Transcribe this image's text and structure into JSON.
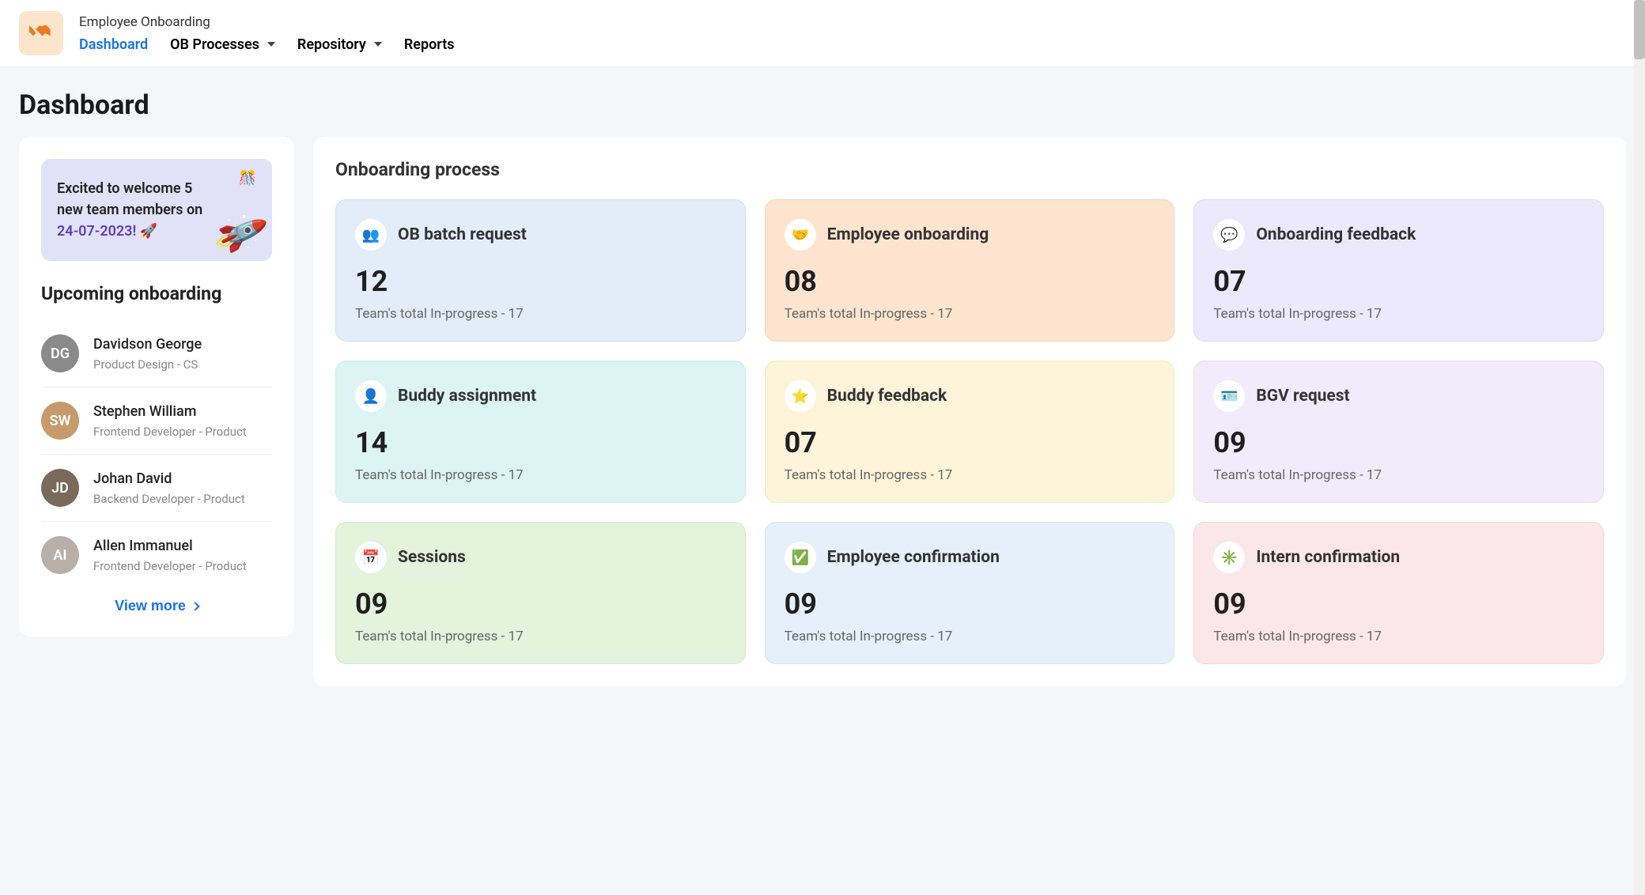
{
  "header": {
    "app_title": "Employee Onboarding",
    "nav": [
      {
        "label": "Dashboard",
        "active": true,
        "dropdown": false
      },
      {
        "label": "OB Processes",
        "active": false,
        "dropdown": true
      },
      {
        "label": "Repository",
        "active": false,
        "dropdown": true
      },
      {
        "label": "Reports",
        "active": false,
        "dropdown": false
      }
    ]
  },
  "page_title": "Dashboard",
  "welcome": {
    "line1": "Excited to welcome 5",
    "line2": "new team members on",
    "date": "24-07-2023!",
    "emoji": "🚀"
  },
  "upcoming": {
    "title": "Upcoming onboarding",
    "users": [
      {
        "name": "Davidson George",
        "role": "Product Design - CS",
        "avatar_bg": "#8a8a8a",
        "initials": "DG"
      },
      {
        "name": "Stephen William",
        "role": "Frontend Developer - Product",
        "avatar_bg": "#c79a6b",
        "initials": "SW"
      },
      {
        "name": "Johan David",
        "role": "Backend Developer - Product",
        "avatar_bg": "#7a6a5a",
        "initials": "JD"
      },
      {
        "name": "Allen Immanuel",
        "role": "Frontend Developer - Product",
        "avatar_bg": "#b8b0a8",
        "initials": "AI"
      }
    ],
    "view_more": "View more"
  },
  "process": {
    "title": "Onboarding process",
    "cards": [
      {
        "title": "OB batch request",
        "count": "12",
        "sub": "Team's total In-progress - 17",
        "color": "c-blue",
        "icon": "👥",
        "icon_name": "batch-icon"
      },
      {
        "title": "Employee onboarding",
        "count": "08",
        "sub": "Team's total In-progress - 17",
        "color": "c-orange",
        "icon": "🤝",
        "icon_name": "handshake-icon"
      },
      {
        "title": "Onboarding feedback",
        "count": "07",
        "sub": "Team's total In-progress - 17",
        "color": "c-purple",
        "icon": "💬",
        "icon_name": "feedback-icon"
      },
      {
        "title": "Buddy assignment",
        "count": "14",
        "sub": "Team's total In-progress - 17",
        "color": "c-cyan",
        "icon": "👤",
        "icon_name": "buddy-icon"
      },
      {
        "title": "Buddy feedback",
        "count": "07",
        "sub": "Team's total In-progress - 17",
        "color": "c-yellow",
        "icon": "⭐",
        "icon_name": "star-icon"
      },
      {
        "title": "BGV request",
        "count": "09",
        "sub": "Team's total In-progress - 17",
        "color": "c-lavender",
        "icon": "🪪",
        "icon_name": "bgv-icon"
      },
      {
        "title": "Sessions",
        "count": "09",
        "sub": "Team's total In-progress - 17",
        "color": "c-green",
        "icon": "📅",
        "icon_name": "calendar-icon"
      },
      {
        "title": "Employee confirmation",
        "count": "09",
        "sub": "Team's total In-progress - 17",
        "color": "c-lightblue",
        "icon": "✅",
        "icon_name": "confirm-icon"
      },
      {
        "title": "Intern confirmation",
        "count": "09",
        "sub": "Team's total In-progress - 17",
        "color": "c-pink",
        "icon": "✳️",
        "icon_name": "intern-icon"
      }
    ]
  }
}
